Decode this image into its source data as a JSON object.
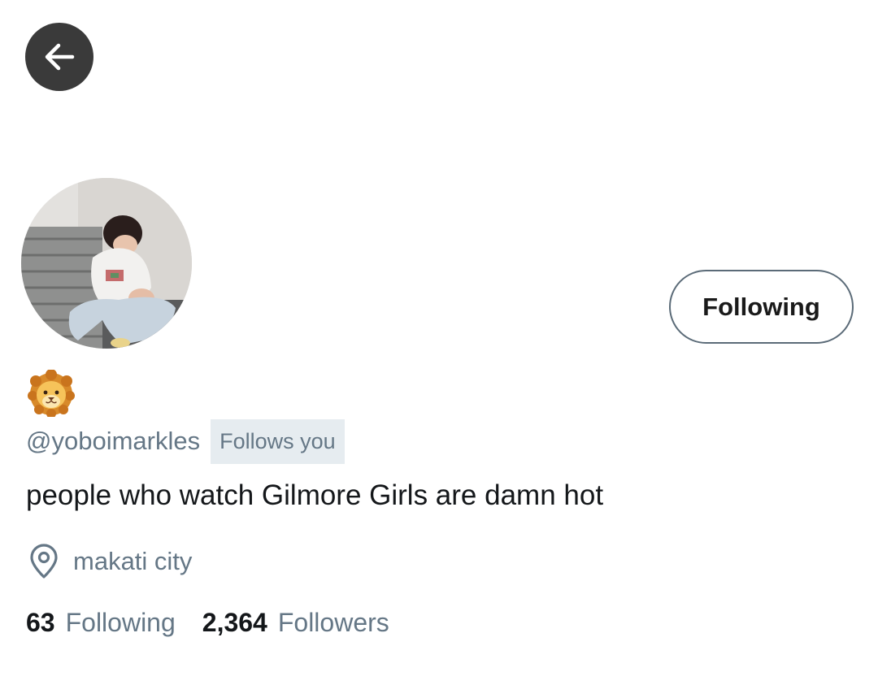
{
  "header": {
    "back_icon": "arrow-left-icon"
  },
  "profile": {
    "avatar_description": "profile-photo",
    "display_name_emoji": "lion-face-emoji",
    "handle": "@yoboimarkles",
    "follows_you_label": "Follows you",
    "follow_button_label": "Following",
    "bio": "people who watch Gilmore Girls are damn hot",
    "location_icon": "location-pin-icon",
    "location": "makati city"
  },
  "stats": {
    "following_count": "63",
    "following_label": "Following",
    "followers_count": "2,364",
    "followers_label": "Followers"
  },
  "colors": {
    "back_button_bg": "#3a3a3a",
    "secondary_text": "#657786",
    "badge_bg": "#e6ecf0",
    "button_border": "#5b6b78"
  }
}
